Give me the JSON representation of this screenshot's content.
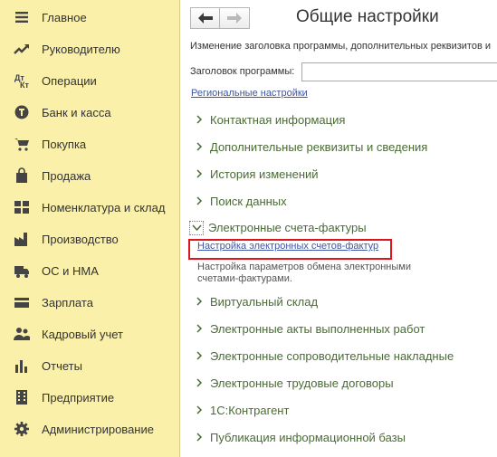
{
  "sidebar": {
    "items": [
      {
        "label": "Главное",
        "icon": "menu-lines-icon"
      },
      {
        "label": "Руководителю",
        "icon": "trend-chart-icon"
      },
      {
        "label": "Операции",
        "icon": "debit-credit-icon"
      },
      {
        "label": "Банк и касса",
        "icon": "coin-icon"
      },
      {
        "label": "Покупка",
        "icon": "cart-icon"
      },
      {
        "label": "Продажа",
        "icon": "shopping-bag-icon"
      },
      {
        "label": "Номенклатура и склад",
        "icon": "grid-blocks-icon"
      },
      {
        "label": "Производство",
        "icon": "factory-icon"
      },
      {
        "label": "ОС и НМА",
        "icon": "truck-icon"
      },
      {
        "label": "Зарплата",
        "icon": "wallet-icon"
      },
      {
        "label": "Кадровый учет",
        "icon": "people-icon"
      },
      {
        "label": "Отчеты",
        "icon": "bar-chart-icon"
      },
      {
        "label": "Предприятие",
        "icon": "building-icon"
      },
      {
        "label": "Администрирование",
        "icon": "gear-icon"
      }
    ]
  },
  "main": {
    "title": "Общие настройки",
    "description": "Изменение заголовка программы, дополнительных реквизитов и",
    "program_title_label": "Заголовок программы:",
    "program_title_value": "",
    "regional_link": "Региональные настройки",
    "sections_top": [
      "Контактная информация",
      "Дополнительные реквизиты и сведения",
      "История изменений",
      "Поиск данных"
    ],
    "expanded_section": {
      "label": "Электронные счета-фактуры",
      "link": "Настройка электронных счетов-фактур",
      "description": "Настройка параметров обмена электронными счетами-фактурами."
    },
    "sections_bottom": [
      "Виртуальный склад",
      "Электронные акты выполненных работ",
      "Электронные сопроводительные накладные",
      "Электронные трудовые договоры",
      "1С:Контрагент",
      "Публикация информационной базы"
    ]
  },
  "colors": {
    "sidebar_bg": "#fbf0a9",
    "section_text": "#4a6b34",
    "link": "#3f55a5",
    "highlight": "#e1131b"
  }
}
